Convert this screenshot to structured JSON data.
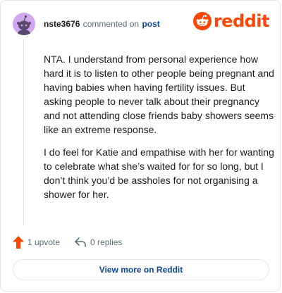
{
  "comment": {
    "username": "nste3676",
    "commented_on": "commented on",
    "post_link": "post",
    "paragraphs": [
      "NTA. I understand from personal experience how hard it is to listen to other people being pregnant and having babies when having fertility issues. But asking people to never talk about their pregnancy and not attending close friends baby showers seems like an extreme response.",
      "I do feel for Katie and empathise with her for wanting to celebrate what she’s waited for for so long, but I don’t think you’d be assholes for not organising a shower for her."
    ]
  },
  "logo": {
    "wordmark": "reddit",
    "color": "#ff4500"
  },
  "actions": {
    "upvotes": "1 upvote",
    "replies": "0 replies"
  },
  "footer": {
    "view_more": "View more on Reddit"
  },
  "icons": {
    "avatar": "snoo-avatar-icon",
    "upvote": "upvote-arrow-icon",
    "reply": "reply-arrow-icon",
    "logo": "reddit-snoo-icon"
  },
  "colors": {
    "accent": "#ff4500",
    "link": "#0a449b",
    "muted": "#576f76",
    "avatar_bg": "#cfa8f0"
  }
}
